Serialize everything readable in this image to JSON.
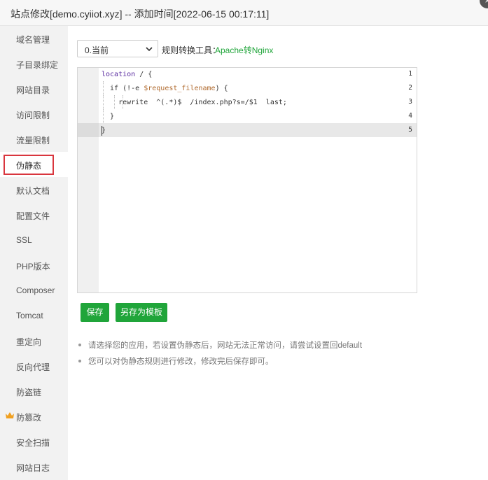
{
  "window": {
    "title": "站点修改[demo.cyiiot.xyz] -- 添加时间[2022-06-15 00:17:11]",
    "close_glyph": "×"
  },
  "sidebar": {
    "items": [
      {
        "label": "域名管理"
      },
      {
        "label": "子目录绑定"
      },
      {
        "label": "网站目录"
      },
      {
        "label": "访问限制"
      },
      {
        "label": "流量限制"
      },
      {
        "label": "伪静态",
        "active": true
      },
      {
        "label": "默认文档"
      },
      {
        "label": "配置文件"
      },
      {
        "label": "SSL"
      },
      {
        "label": "PHP版本"
      },
      {
        "label": "Composer"
      },
      {
        "label": "Tomcat"
      },
      {
        "label": "重定向"
      },
      {
        "label": "反向代理"
      },
      {
        "label": "防盗链"
      },
      {
        "label": "防篡改",
        "icon": "crown-icon"
      },
      {
        "label": "安全扫描"
      },
      {
        "label": "网站日志"
      }
    ]
  },
  "toolbar": {
    "selected_template": "0.当前",
    "converter_label": "规则转换工具：",
    "converter_link": "Apache转Nginx"
  },
  "editor": {
    "line_numbers": [
      "1",
      "2",
      "3",
      "4",
      "5"
    ],
    "lines": [
      {
        "kw": "location",
        "rest": " / {"
      },
      {
        "pre": "  if (!-e ",
        "var": "$request_filename",
        "post": ") {"
      },
      {
        "text": "    rewrite  ^(.*)$  /index.php?s=/$1  last;"
      },
      {
        "text": "  }"
      },
      {
        "text": "}"
      }
    ],
    "active_line": 5
  },
  "buttons": {
    "save": "保存",
    "save_as_template": "另存为模板"
  },
  "tips": [
    "请选择您的应用，若设置伪静态后，网站无法正常访问，请尝试设置回default",
    "您可以对伪静态规则进行修改，修改完后保存即可。"
  ],
  "colors": {
    "accent_green": "#20a53a",
    "active_border": "#d9363e",
    "crown": "#f0a020"
  }
}
